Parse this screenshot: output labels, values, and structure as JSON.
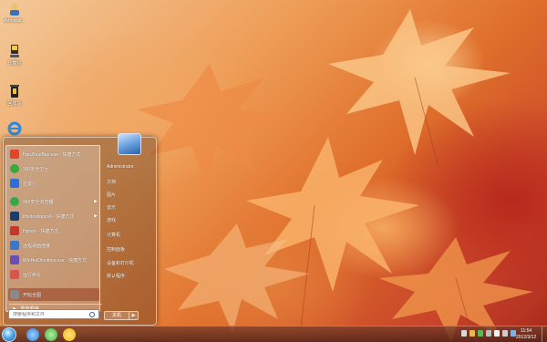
{
  "desktop_icons": [
    {
      "label": "Administ...",
      "icon": "user-folder-icon"
    },
    {
      "label": "计算机",
      "icon": "computer-icon"
    },
    {
      "label": "回收站",
      "icon": "recycle-bin-icon"
    },
    {
      "label": "",
      "icon": "internet-explorer-icon"
    }
  ],
  "start_menu": {
    "programs": [
      {
        "label": "HaoZhuoBao.exe - 快捷方式",
        "icon": "haozhuobao-icon",
        "color": "#e0442a",
        "arrow": ""
      },
      {
        "label": "360安全卫士",
        "icon": "360-safe-icon",
        "color": "#3aa93c",
        "arrow": ""
      },
      {
        "label": "迅雷7",
        "icon": "thunder-icon",
        "color": "#2f6fd3",
        "arrow": ""
      },
      {
        "label": "360安全浏览器",
        "icon": "360-browser-icon",
        "color": "#37a84a",
        "arrow": "▶"
      },
      {
        "label": "Photoshopcs6 - 快捷方式",
        "icon": "photoshop-icon",
        "color": "#1c3c6e",
        "arrow": "▶"
      },
      {
        "label": "Hprsnr - 快捷方式",
        "icon": "hprsnr-icon",
        "color": "#c0392b",
        "arrow": ""
      },
      {
        "label": "远程桌面连接",
        "icon": "remote-desktop-icon",
        "color": "#3b78c8",
        "arrow": ""
      },
      {
        "label": "WinHeiOtoolbox.exe - 快捷方式",
        "icon": "toolbox-icon",
        "color": "#6a4fb3",
        "arrow": ""
      },
      {
        "label": "运行命令",
        "icon": "run-icon",
        "color": "#d9534f",
        "arrow": ""
      },
      {
        "label": "开始全图",
        "icon": "start-icon",
        "color": "#8a8a8a",
        "arrow": ""
      }
    ],
    "all_programs": "所有程序",
    "search_placeholder": "搜索程序和文件",
    "right_items": [
      "Administrator",
      "文档",
      "图片",
      "音乐",
      "游戏",
      "计算机",
      "控制面板",
      "设备和打印机",
      "默认程序"
    ],
    "shutdown_label": "关机",
    "shutdown_arrow": "▶"
  },
  "taskbar": {
    "buttons": [
      {
        "icon": "internet-explorer-icon",
        "color": "#2b7bd6"
      },
      {
        "icon": "360-browser-icon",
        "color": "#3cb043"
      },
      {
        "icon": "chrome-icon",
        "color": "#f4b400"
      }
    ],
    "clock_time": "11:54",
    "clock_date": "2012/3/12"
  }
}
